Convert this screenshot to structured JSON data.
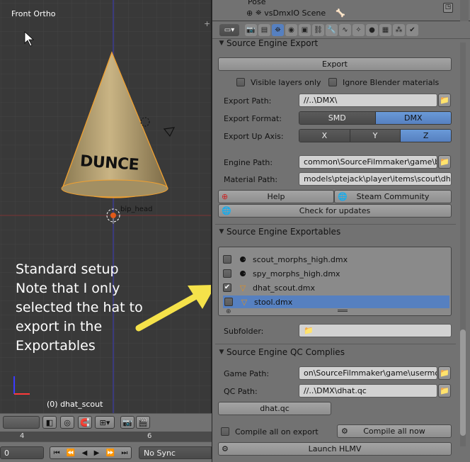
{
  "viewport": {
    "view_label": "Front Ortho",
    "object_text": "DUNCE",
    "bone_label": "bip_head",
    "object_name": "(0) dhat_scout",
    "annotation": "Standard setup\nNote that I only\nselected the hat to\nexport in the\nExportables"
  },
  "timeline": {
    "ruler_numbers": [
      "4",
      "6"
    ],
    "current_frame": "0",
    "sync_mode": "No Sync"
  },
  "outliner": {
    "scene_name": "vsDmxIO Scene",
    "partial_item": "Pose"
  },
  "export_panel": {
    "title": "Source Engine Export",
    "export_button": "Export",
    "visible_layers_only": "Visible layers only",
    "ignore_materials": "Ignore Blender materials",
    "export_path_label": "Export Path:",
    "export_path_value": "//..\\DMX\\",
    "export_format_label": "Export Format:",
    "format_options": [
      "SMD",
      "DMX"
    ],
    "format_selected": "DMX",
    "up_axis_label": "Export Up Axis:",
    "axis_options": [
      "X",
      "Y",
      "Z"
    ],
    "axis_selected": "Z",
    "engine_path_label": "Engine Path:",
    "engine_path_value": "common\\SourceFilmmaker\\game\\bin\\",
    "material_path_label": "Material Path:",
    "material_path_value": "models\\ptejack\\player\\items\\scout\\dhat",
    "help_button": "Help",
    "steam_button": "Steam Community",
    "updates_button": "Check for updates"
  },
  "exportables_panel": {
    "title": "Source Engine Exportables",
    "items": [
      {
        "name": "scout_morphs_high.dmx",
        "checked": false,
        "selected": false
      },
      {
        "name": "spy_morphs_high.dmx",
        "checked": false,
        "selected": false
      },
      {
        "name": "dhat_scout.dmx",
        "checked": true,
        "selected": false
      },
      {
        "name": "stool.dmx",
        "checked": false,
        "selected": true
      }
    ],
    "subfolder_label": "Subfolder:"
  },
  "qc_panel": {
    "title": "Source Engine QC Complies",
    "game_path_label": "Game Path:",
    "game_path_value": "on\\SourceFilmmaker\\game\\usermod\\",
    "qc_path_label": "QC Path:",
    "qc_path_value": "//..\\DMX\\dhat.qc",
    "qc_file_button": "dhat.qc",
    "compile_on_export": "Compile all on export",
    "compile_now": "Compile all now",
    "launch_hlmv": "Launch HLMV"
  },
  "colors": {
    "viewport_bg": "#393939",
    "panel_bg": "#727272",
    "selection_blue": "#5680c0",
    "arrow_yellow": "#f5e24a",
    "hat_tan": "#b8a271",
    "outline_orange": "#f0a030"
  }
}
